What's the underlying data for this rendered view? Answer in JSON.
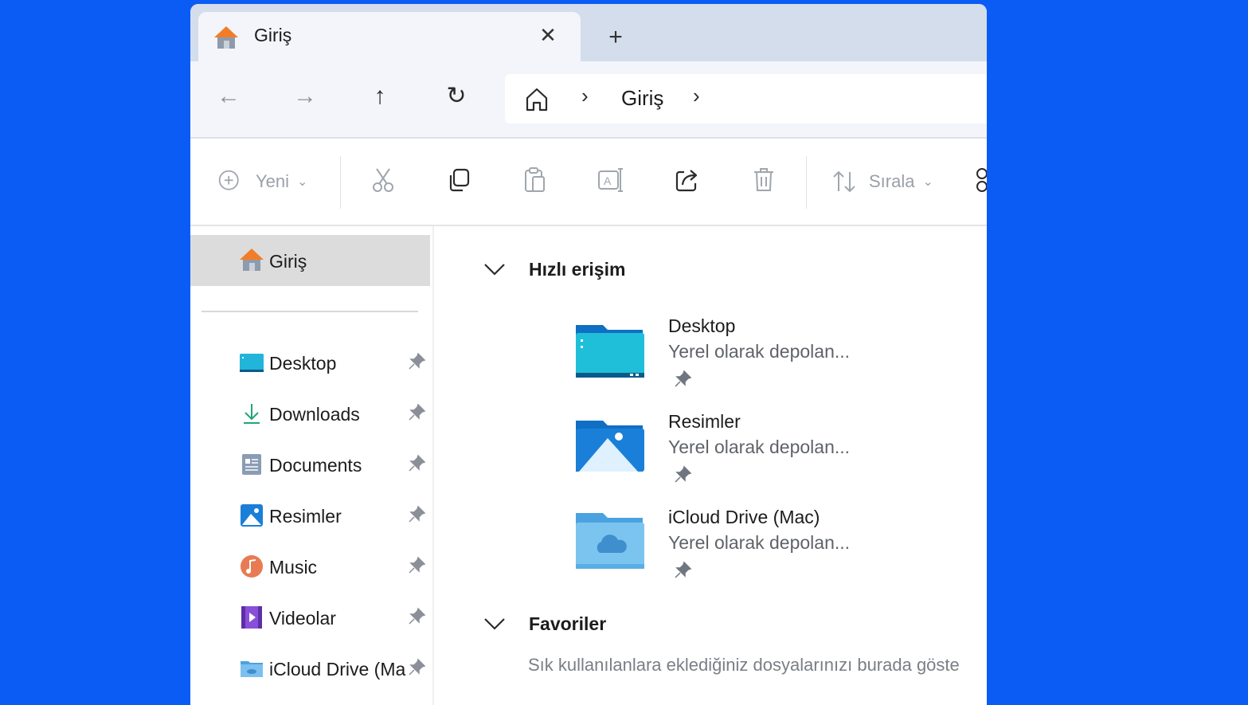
{
  "tab": {
    "title": "Giriş",
    "close_glyph": "✕",
    "new_tab_glyph": "+"
  },
  "nav": {
    "back_glyph": "←",
    "forward_glyph": "→",
    "up_glyph": "↑",
    "refresh_glyph": "↻",
    "breadcrumb": "Giriş",
    "chevron": "›"
  },
  "toolbar": {
    "new_label": "Yeni",
    "sort_label": "Sırala",
    "icons": [
      "plus-circle-icon",
      "cut-icon",
      "copy-icon",
      "paste-icon",
      "rename-icon",
      "share-icon",
      "delete-icon",
      "sort-icon",
      "view-icon"
    ]
  },
  "sidebar": {
    "home_label": "Giriş",
    "items": [
      {
        "label": "Desktop",
        "icon": "desktop-folder-icon"
      },
      {
        "label": "Downloads",
        "icon": "download-icon"
      },
      {
        "label": "Documents",
        "icon": "documents-icon"
      },
      {
        "label": "Resimler",
        "icon": "pictures-icon"
      },
      {
        "label": "Music",
        "icon": "music-icon"
      },
      {
        "label": "Videolar",
        "icon": "videos-icon"
      },
      {
        "label": "iCloud Drive (Mac)",
        "icon": "icloud-folder-icon"
      }
    ]
  },
  "main": {
    "quick_access": {
      "title": "Hızlı erişim",
      "items": [
        {
          "name": "Desktop",
          "sub": "Yerel olarak depolan...",
          "icon": "desktop-folder-icon"
        },
        {
          "name": "Resimler",
          "sub": "Yerel olarak depolan...",
          "icon": "pictures-folder-icon"
        },
        {
          "name": "iCloud Drive (Mac)",
          "sub": "Yerel olarak depolan...",
          "icon": "icloud-folder-icon"
        }
      ]
    },
    "favorites": {
      "title": "Favoriler",
      "empty_text": "Sık kullanılanlara eklediğiniz dosyalarınızı burada göste"
    }
  },
  "colors": {
    "background": "#0b5cf5",
    "tabbar": "#d3ddeb",
    "selected": "#dcdcdc"
  }
}
